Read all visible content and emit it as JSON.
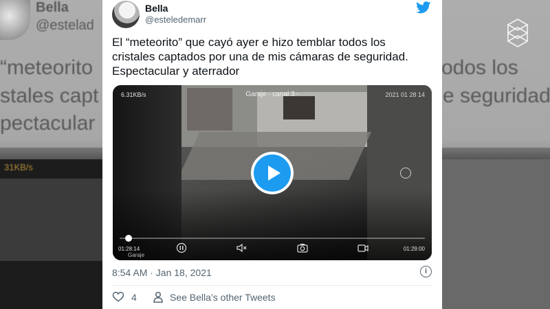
{
  "tweet": {
    "display_name": "Bella",
    "handle": "@esteledemarr",
    "text_lines": [
      "El “meteorito” que cayó ayer e hizo temblar todos los",
      "cristales captados por una de mis cámaras de seguridad.",
      "Espectacular y aterrador"
    ],
    "timestamp": "8:54 AM · Jan 18, 2021",
    "like_count": "4",
    "other_tweets_label": "See Bella’s other Tweets",
    "info_glyph": "i"
  },
  "video": {
    "camera_title": "Garaje - canal 3 -",
    "speed": "6.31KB/s",
    "date": "2021 01 28 14",
    "current_time": "01:28:14",
    "end_time": "01:29:00",
    "camera_label": "Garaje",
    "progress": 0.03
  },
  "backdrop": {
    "name": "Bella",
    "handle": "@estelad",
    "line1": "“meteorito",
    "line1b": "odos los",
    "line2": "stales capt",
    "line2b": "e seguridad",
    "line3": "pectacular",
    "speed": "31KB/s"
  },
  "colors": {
    "accent": "#1d9bf0",
    "text_primary": "#0f1419",
    "text_secondary": "#536471"
  },
  "icons": [
    "twitter-bird-icon",
    "play-icon",
    "pause-icon",
    "mute-icon",
    "camera-icon",
    "record-icon",
    "info-icon",
    "heart-icon",
    "person-icon",
    "watermark-icon",
    "rotate-icon"
  ]
}
